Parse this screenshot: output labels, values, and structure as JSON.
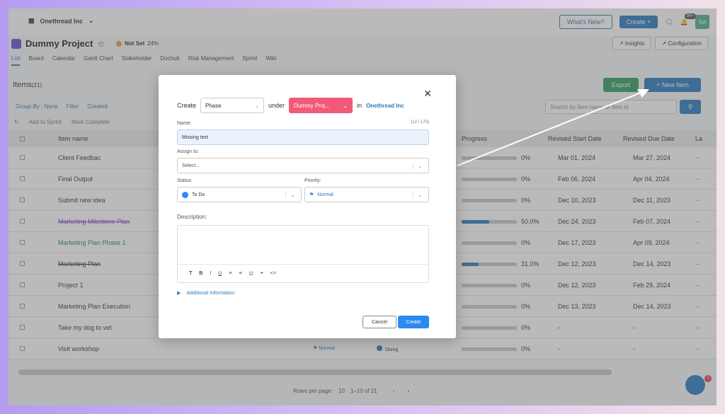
{
  "header": {
    "org_name": "Onethread Inc",
    "whats_new": "What's New?",
    "create": "Create +",
    "notif_badge": "99+",
    "avatar_initials": "SA"
  },
  "project": {
    "title": "Dummy Project",
    "status": "Not Set",
    "percent": "24%",
    "insights": "Insights",
    "configuration": "Configuration"
  },
  "tabs": [
    "List",
    "Board",
    "Calendar",
    "Gantt Chart",
    "Stakeholder",
    "Dochub",
    "Risk Management",
    "Sprint",
    "Wiki"
  ],
  "items": {
    "title": "Items",
    "count": "(21)",
    "export": "Export",
    "new_item": "+ New Item",
    "group_by": "Group By : None",
    "filter": "Filter",
    "created": "Created",
    "add_to_sprint": "Add to Sprint",
    "mark_complete": "Mark Complete",
    "search_placeholder": "Search by item name or item id"
  },
  "table": {
    "headers": {
      "item_name": "Item name",
      "progress": "Progress",
      "revised_start": "Revised Start Date",
      "revised_due": "Revised Due Date",
      "last": "La"
    },
    "rows": [
      {
        "name": "Client Feedbac",
        "progress": "0%",
        "start": "Mar 01, 2024",
        "due": "Mar 27, 2024",
        "fill": 0
      },
      {
        "name": "Final Output",
        "progress": "0%",
        "start": "Feb 06, 2024",
        "due": "Apr 04, 2024",
        "fill": 0
      },
      {
        "name": "Submit new idea",
        "progress": "0%",
        "start": "Dec 10, 2023",
        "due": "Dec 11, 2023",
        "fill": 0
      },
      {
        "name": "Marketing Milestone Plan",
        "progress": "50.0%",
        "start": "Dec 24, 2023",
        "due": "Feb 07, 2024",
        "fill": 0.5
      },
      {
        "name": "Marketing Plan Phase 1",
        "progress": "0%",
        "start": "Dec 17, 2023",
        "due": "Apr 09, 2024",
        "fill": 0
      },
      {
        "name": "Marketing Plan",
        "progress": "31.0%",
        "start": "Dec 12, 2023",
        "due": "Dec 14, 2023",
        "fill": 0.31
      },
      {
        "name": "Project 1",
        "progress": "0%",
        "start": "Dec 12, 2023",
        "due": "Feb 29, 2024",
        "fill": 0
      },
      {
        "name": "Marketing Plan Execution",
        "progress": "0%",
        "start": "Dec 13, 2023",
        "due": "Dec 14, 2023",
        "fill": 0
      },
      {
        "name": "Take my dog to vet",
        "progress": "0%",
        "start": "-",
        "due": "-",
        "fill": 0
      },
      {
        "name": "Visit workshop",
        "progress": "0%",
        "start": "-",
        "due": "-",
        "fill": 0,
        "priority": "Normal",
        "status": "Doing"
      }
    ],
    "dash": "-"
  },
  "pager": {
    "rows_per_page": "Rows per page:",
    "rows_value": "10",
    "range": "1–10 of 21"
  },
  "chat_badge": "1",
  "modal": {
    "create_label": "Create",
    "type_value": "Phase",
    "under_label": "under",
    "parent_value": "Dummy Proj...",
    "in_label": "in",
    "org_link": "Onethread Inc",
    "name_label": "Name:",
    "name_count": "(12 / 170)",
    "name_value": "Missing text",
    "assign_label": "Assign to:",
    "assign_placeholder": "Select...",
    "status_label": "Status:",
    "status_value": "To Do",
    "priority_label": "Priority:",
    "priority_value": "Normal",
    "description_label": "Description:",
    "additional_info": "Additional Information",
    "cancel": "Cancel",
    "create": "Create"
  },
  "colors": {
    "accent": "#2a7ac0",
    "export_green": "#2f9e63",
    "parent_pink": "#f25a78",
    "status_blue": "#2a8af0"
  }
}
